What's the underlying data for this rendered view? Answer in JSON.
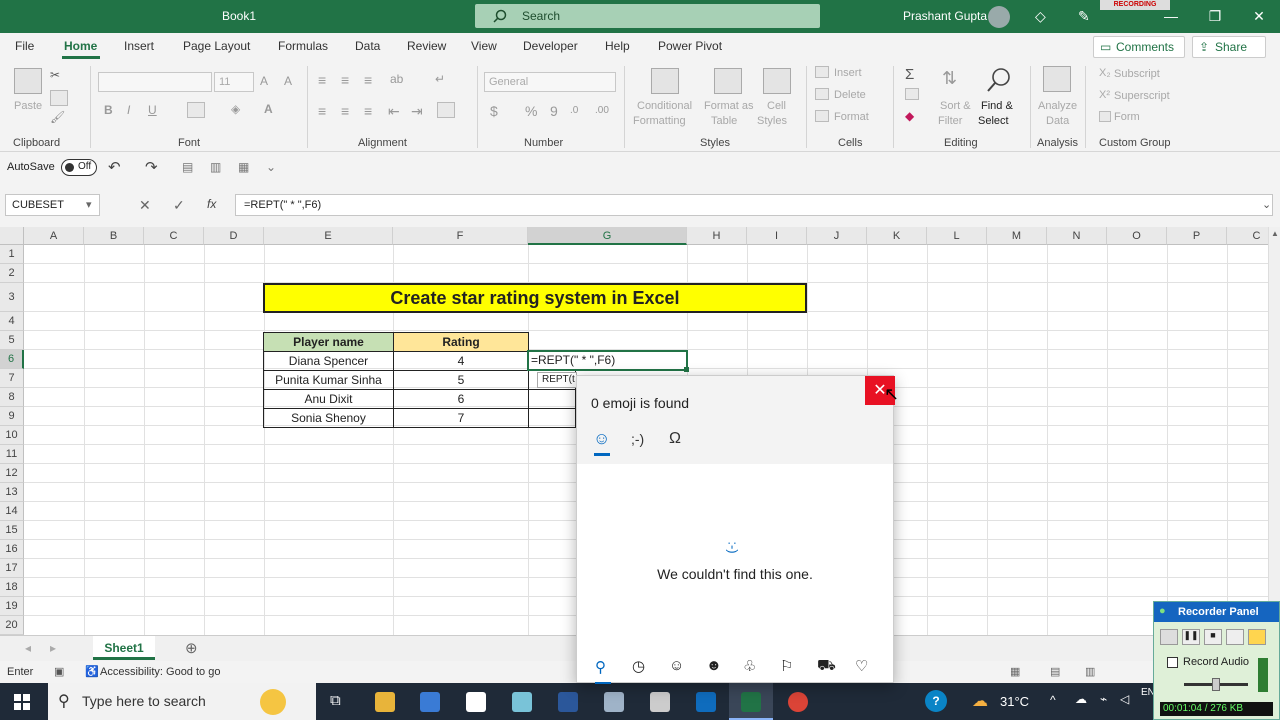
{
  "window": {
    "title": "Book1",
    "search_placeholder": "Search",
    "user": "Prashant Gupta",
    "rec_badge": "RECORDING"
  },
  "tabs": [
    "File",
    "Home",
    "Insert",
    "Page Layout",
    "Formulas",
    "Data",
    "Review",
    "View",
    "Developer",
    "Help",
    "Power Pivot"
  ],
  "top_buttons": {
    "comments": "Comments",
    "share": "Share"
  },
  "ribbon": {
    "clipboard": {
      "paste": "Paste",
      "label": "Clipboard"
    },
    "font": {
      "name": "",
      "size": "11",
      "bold": "B",
      "italic": "I",
      "underline": "U",
      "label": "Font"
    },
    "alignment": {
      "label": "Alignment"
    },
    "number": {
      "format": "General",
      "label": "Number"
    },
    "styles": {
      "conditional": "Conditional",
      "conditional2": "Formatting",
      "format_as": "Format as",
      "format_as2": "Table",
      "cell": "Cell",
      "cell2": "Styles",
      "label": "Styles"
    },
    "cells": {
      "insert": "Insert",
      "delete": "Delete",
      "format": "Format",
      "label": "Cells"
    },
    "editing": {
      "sort": "Sort &",
      "sort2": "Filter",
      "find": "Find &",
      "find2": "Select",
      "label": "Editing"
    },
    "analysis": {
      "analyze": "Analyze",
      "analyze2": "Data",
      "label": "Analysis"
    },
    "custom": {
      "subscript": "Subscript",
      "superscript": "Superscript",
      "form": "Form",
      "label": "Custom Group"
    }
  },
  "qat": {
    "autosave": "AutoSave",
    "toggle": "Off"
  },
  "formula_bar": {
    "name_box": "CUBESET",
    "fx": "fx",
    "formula": "=REPT(\" * \",F6)"
  },
  "columns": [
    "A",
    "B",
    "C",
    "D",
    "E",
    "F",
    "G",
    "H",
    "I",
    "J",
    "K",
    "L",
    "M",
    "N",
    "O",
    "P",
    "C"
  ],
  "rows": [
    "1",
    "2",
    "3",
    "4",
    "5",
    "6",
    "7",
    "8",
    "9",
    "10",
    "11",
    "12",
    "13",
    "14",
    "15",
    "16",
    "17",
    "18",
    "19",
    "20"
  ],
  "sheet": {
    "title": "Create star rating system in Excel",
    "headers": [
      "Player name",
      "Rating"
    ],
    "players": [
      {
        "name": "Diana Spencer",
        "rating": "4"
      },
      {
        "name": "Punita Kumar Sinha",
        "rating": "5"
      },
      {
        "name": "Anu Dixit",
        "rating": "6"
      },
      {
        "name": "Sonia Shenoy",
        "rating": "7"
      }
    ],
    "edit_cell": "=REPT(\" * \",F6)",
    "tooltip": "REPT(t"
  },
  "sheet_tab": "Sheet1",
  "status": {
    "mode": "Enter",
    "accessibility": "Accessibility: Good to go"
  },
  "emoji_panel": {
    "found": "0 emoji is found",
    "message": "We couldn't find this one.",
    "emoticon_tab": ";-)",
    "symbol_tab": "Ω",
    "empty_glyph": ":-)"
  },
  "taskbar": {
    "search": "Type here to search",
    "temp": "31°C",
    "lang": "EN"
  },
  "recorder": {
    "title": "Recorder Panel",
    "record_audio": "Record Audio",
    "time": "00:01:04 / 276 KB"
  },
  "colors": {
    "excel_green": "#217346",
    "title_fill": "#ffff00",
    "header_name": "#c6e0b4",
    "header_rating": "#ffe699"
  }
}
